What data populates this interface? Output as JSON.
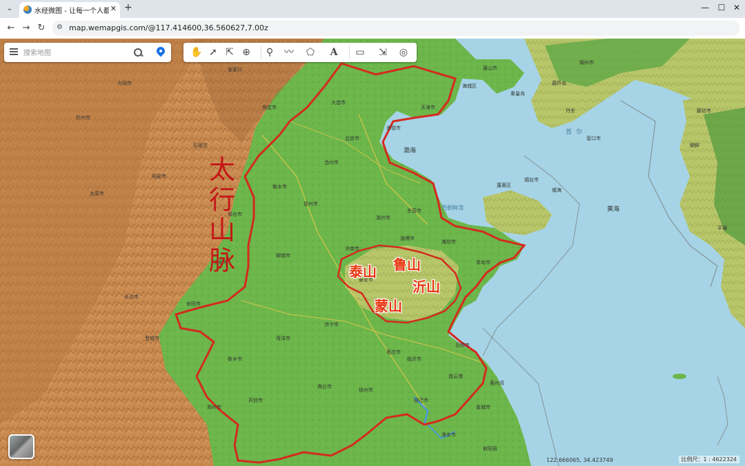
{
  "browser": {
    "tab_title": "水经微图 - 让每一个人都有自己的",
    "close_glyph": "✕",
    "newtab_glyph": "+",
    "url": "map.wemapgis.com/@117.414600,36.560627,7.00z",
    "window_controls": [
      "—",
      "☐",
      "✕"
    ],
    "nav": [
      "←",
      "→",
      "↻"
    ]
  },
  "map_ui": {
    "search_placeholder": "搜索地图",
    "toolbar_icons": [
      "pan-hand-icon",
      "select-arrow-icon",
      "multi-select-icon",
      "zoom-icon",
      "marker-icon",
      "polyline-icon",
      "polygon-icon",
      "text-icon",
      "ruler-icon",
      "pointer-icon",
      "globe-icon"
    ],
    "coordinates": "122.666065, 34.423749",
    "scale": "比例尺：1 : 4622324"
  },
  "annotations": {
    "mountain_range": [
      "太",
      "行",
      "山",
      "脉"
    ],
    "tai": "泰山",
    "lu": "鲁山",
    "yi": "沂山",
    "meng": "蒙山"
  },
  "places": [
    "海城区",
    "丹东",
    "朝鲜",
    "渤海",
    "黄海",
    "烟台市",
    "威海",
    "蓬莱区",
    "济南市",
    "石家庄",
    "保定市",
    "邢台市",
    "邯郸市",
    "德州市",
    "沧州市",
    "聊城市",
    "临沂市",
    "日照市",
    "徐州市",
    "连云港",
    "淄博市",
    "青岛市",
    "潍坊市",
    "衡水市",
    "东营市",
    "滨州市",
    "泰安市",
    "济宁市",
    "菏泽市",
    "枣庄市",
    "宿迁市",
    "淮安市",
    "盐城市",
    "商丘市",
    "开封市",
    "郑州市",
    "新乡市",
    "安阳市",
    "长治市",
    "晋城市",
    "阳泉市",
    "太原市",
    "忻州市",
    "大同市",
    "张家口",
    "承德市",
    "天津市",
    "唐山市",
    "秦皇岛",
    "葫芦岛",
    "锦州市",
    "营口市",
    "大连市",
    "北京市",
    "廊坊市",
    "平壤",
    "首尔",
    "西朝鲜湾",
    "莱州湾",
    "射阳县",
    "东台市"
  ],
  "colors": {
    "sea": "#a6d4e6",
    "plain": "#6bb64a",
    "mountain_brown": "#c7844a",
    "annotation_red": "#d42a1e",
    "label_orange": "#e8360f"
  }
}
